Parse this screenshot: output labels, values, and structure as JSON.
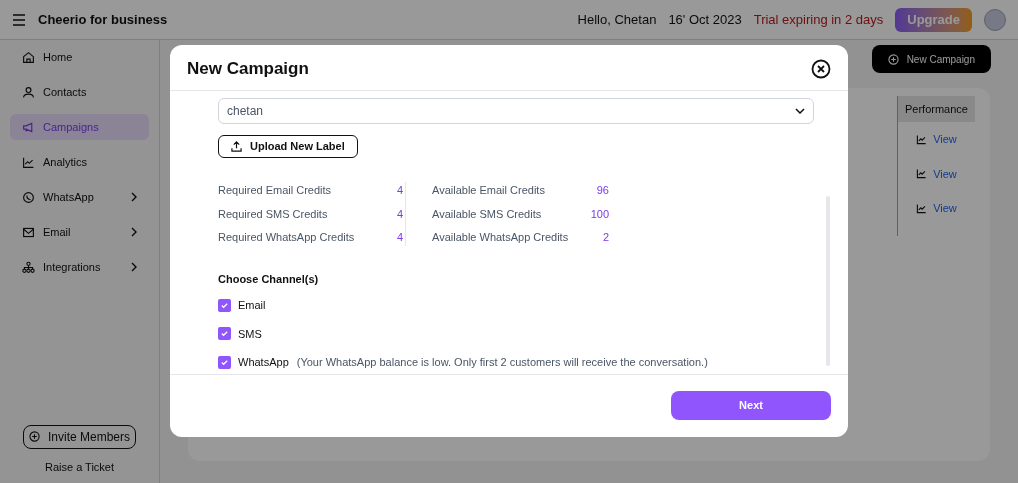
{
  "topbar": {
    "brand": "Cheerio for business",
    "greeting": "Hello, Chetan",
    "date": "16' Oct 2023",
    "trial": "Trial expiring in 2 days",
    "upgrade": "Upgrade"
  },
  "sidebar": {
    "items": [
      {
        "label": "Home",
        "selected": false,
        "expandable": false
      },
      {
        "label": "Contacts",
        "selected": false,
        "expandable": false
      },
      {
        "label": "Campaigns",
        "selected": true,
        "expandable": false
      },
      {
        "label": "Analytics",
        "selected": false,
        "expandable": false
      },
      {
        "label": "WhatsApp",
        "selected": false,
        "expandable": true
      },
      {
        "label": "Email",
        "selected": false,
        "expandable": true
      },
      {
        "label": "Integrations",
        "selected": false,
        "expandable": true
      }
    ],
    "invite": "Invite Members",
    "ticket": "Raise a Ticket"
  },
  "main": {
    "new_campaign": "New Campaign",
    "table": {
      "column": "Performance",
      "rows": [
        "View",
        "View",
        "View"
      ]
    }
  },
  "modal": {
    "title": "New Campaign",
    "segment": "chetan",
    "upload": "Upload New Label",
    "required": [
      {
        "label": "Required Email Credits",
        "value": "4"
      },
      {
        "label": "Required SMS Credits",
        "value": "4"
      },
      {
        "label": "Required WhatsApp Credits",
        "value": "4"
      }
    ],
    "available": [
      {
        "label": "Available Email Credits",
        "value": "96"
      },
      {
        "label": "Available SMS Credits",
        "value": "100"
      },
      {
        "label": "Available WhatsApp Credits",
        "value": "2"
      }
    ],
    "channels_title": "Choose Channel(s)",
    "channels": [
      {
        "label": "Email",
        "checked": true
      },
      {
        "label": "SMS",
        "checked": true
      },
      {
        "label": "WhatsApp",
        "checked": true,
        "note": "(Your WhatsApp balance is low. Only first 2 customers will receive the conversation.)"
      }
    ],
    "next": "Next"
  }
}
